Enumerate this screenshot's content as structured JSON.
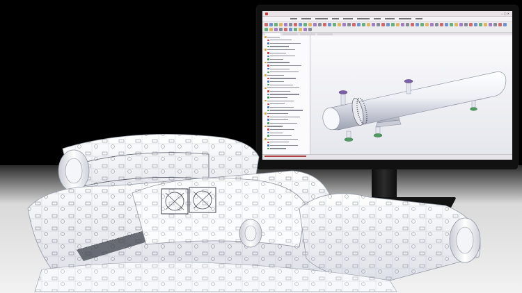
{
  "scene": {
    "description_items": [
      "monitor",
      "blueprint-rolls"
    ],
    "colors": {
      "background": "#000000",
      "floor": "#efefef",
      "paper": "#f7f8fb",
      "ink": "#3b3f4a",
      "pipe": "#eef0f6",
      "flange_purple": "#7b5ea8",
      "flange_green": "#4f9a5e",
      "accent_red": "#b03838"
    }
  },
  "screen": {
    "icons": [
      "red-app-icon",
      "window-controls"
    ],
    "viewport_model": "horizontal-heat-exchanger-vessel"
  }
}
